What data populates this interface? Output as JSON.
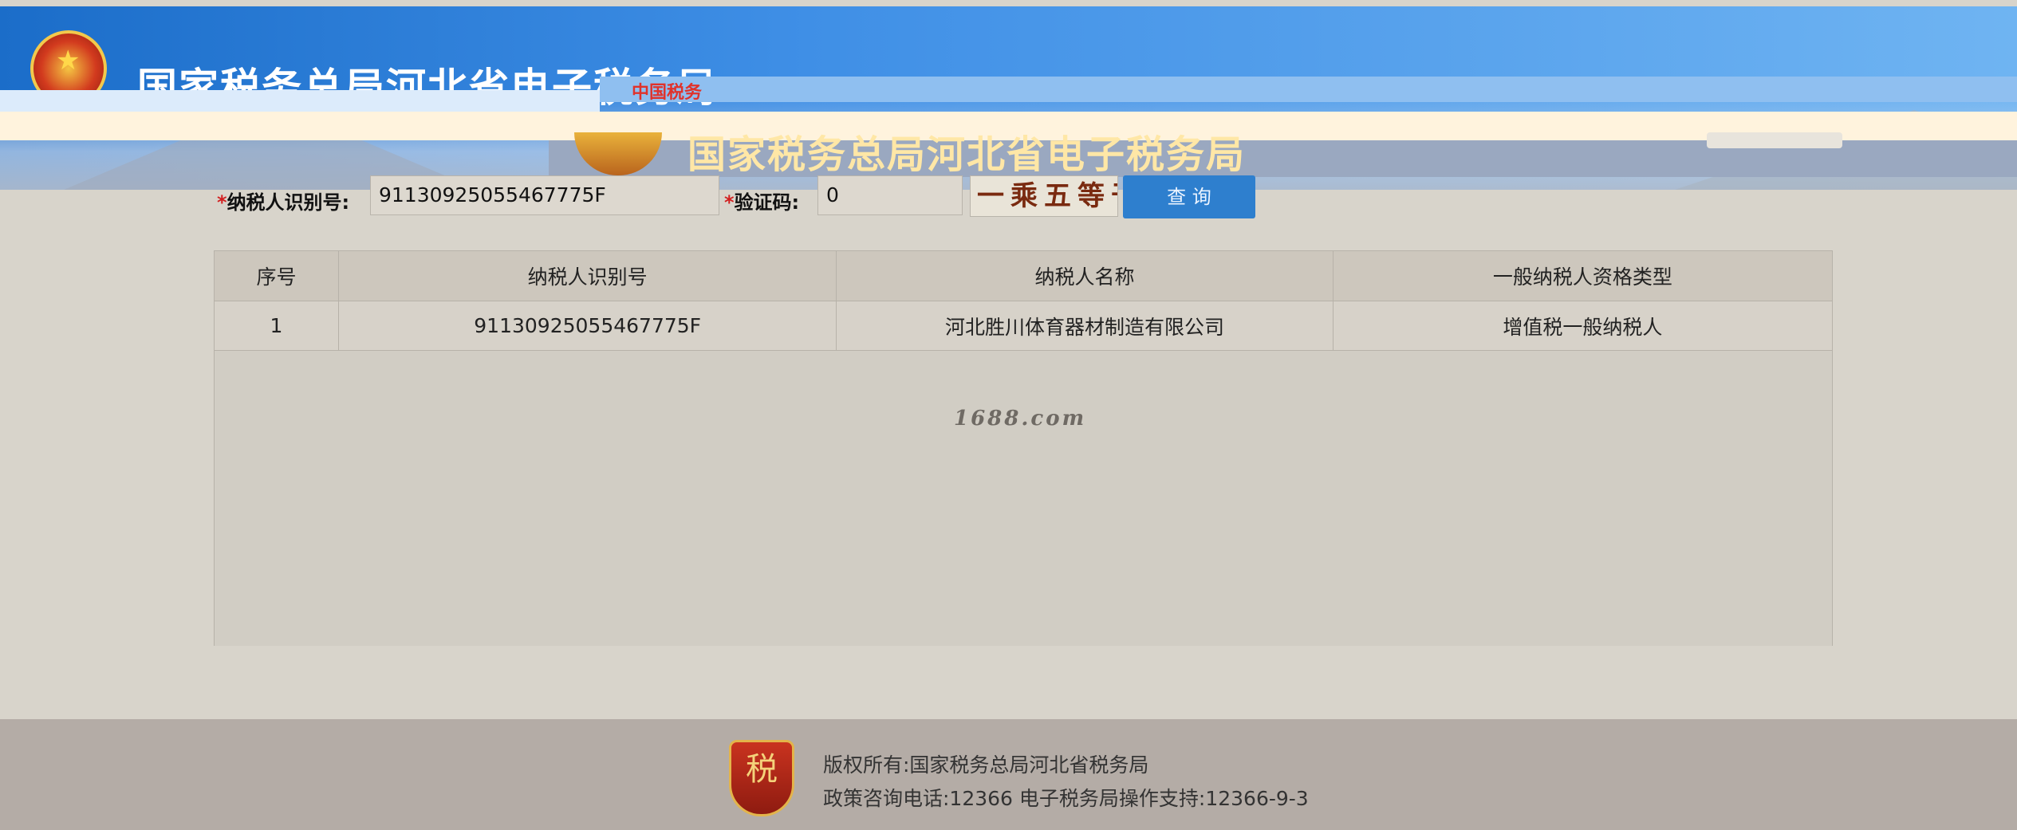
{
  "header": {
    "site_title": "国家税务总局河北省电子税务局",
    "overlay_title": "国家税务总局河北省电子税务局",
    "stamp_text": "中国税务"
  },
  "search": {
    "taxpayer_id_label": "纳税人识别号:",
    "taxpayer_id_value": "91130925055467775F",
    "captcha_label": "验证码:",
    "captcha_value": "0",
    "captcha_image_text": "一乘五等于?",
    "query_button": "查 询",
    "required_mark": "*"
  },
  "table": {
    "columns": [
      "序号",
      "纳税人识别号",
      "纳税人名称",
      "一般纳税人资格类型"
    ],
    "rows": [
      [
        "1",
        "91130925055467775F",
        "河北胜川体育器材制造有限公司",
        "增值税一般纳税人"
      ]
    ]
  },
  "watermark": "1688.com",
  "footer": {
    "logo_text": "税",
    "copyright": "版权所有:国家税务总局河北省税务局",
    "contact": "政策咨询电话:12366  电子税务局操作支持:12366-9-3"
  }
}
